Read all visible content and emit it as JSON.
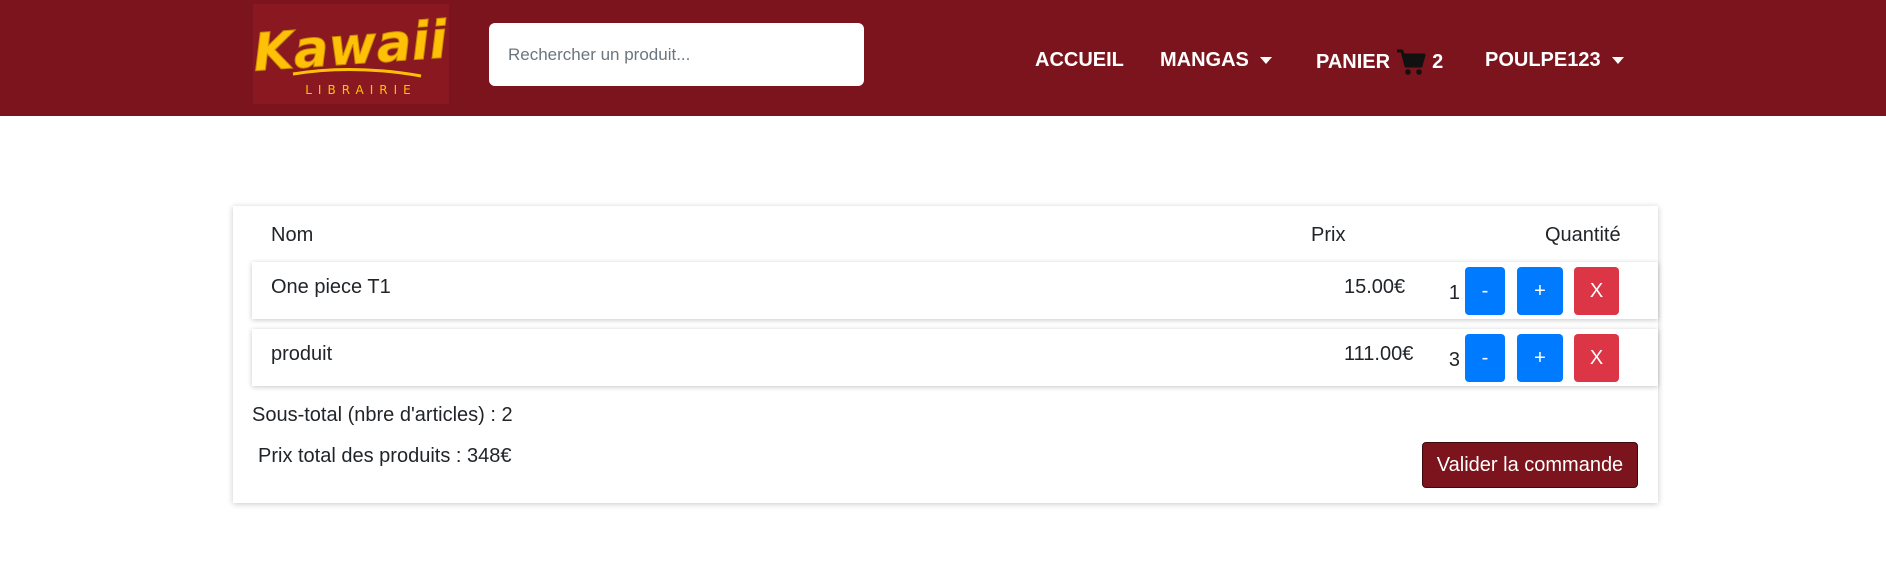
{
  "colors": {
    "brand": "#7b141c",
    "primary": "#007bff",
    "danger": "#dc3545"
  },
  "header": {
    "logo_text": "Kawaii",
    "logo_subtext": "LIBRAIRIE",
    "search_placeholder": "Rechercher un produit...",
    "nav": {
      "home": "ACCUEIL",
      "mangas": "MANGAS",
      "cart": "PANIER",
      "cart_count": "2",
      "user": "POULPE123"
    },
    "icons": {
      "cart": "shopping-cart-icon",
      "dropdown": "caret-down-icon"
    }
  },
  "cart": {
    "columns": {
      "name": "Nom",
      "price": "Prix",
      "quantity": "Quantité"
    },
    "items": [
      {
        "name": "One piece T1",
        "price": "15.00€",
        "quantity": "1",
        "minus": "-",
        "plus": "+",
        "remove": "X"
      },
      {
        "name": "produit",
        "price": "111.00€",
        "quantity": "3",
        "minus": "-",
        "plus": "+",
        "remove": "X"
      }
    ],
    "subtotal": "Sous-total (nbre d'articles) : 2",
    "total": "Prix total des produits : 348€",
    "validate_label": "Valider la commande"
  }
}
